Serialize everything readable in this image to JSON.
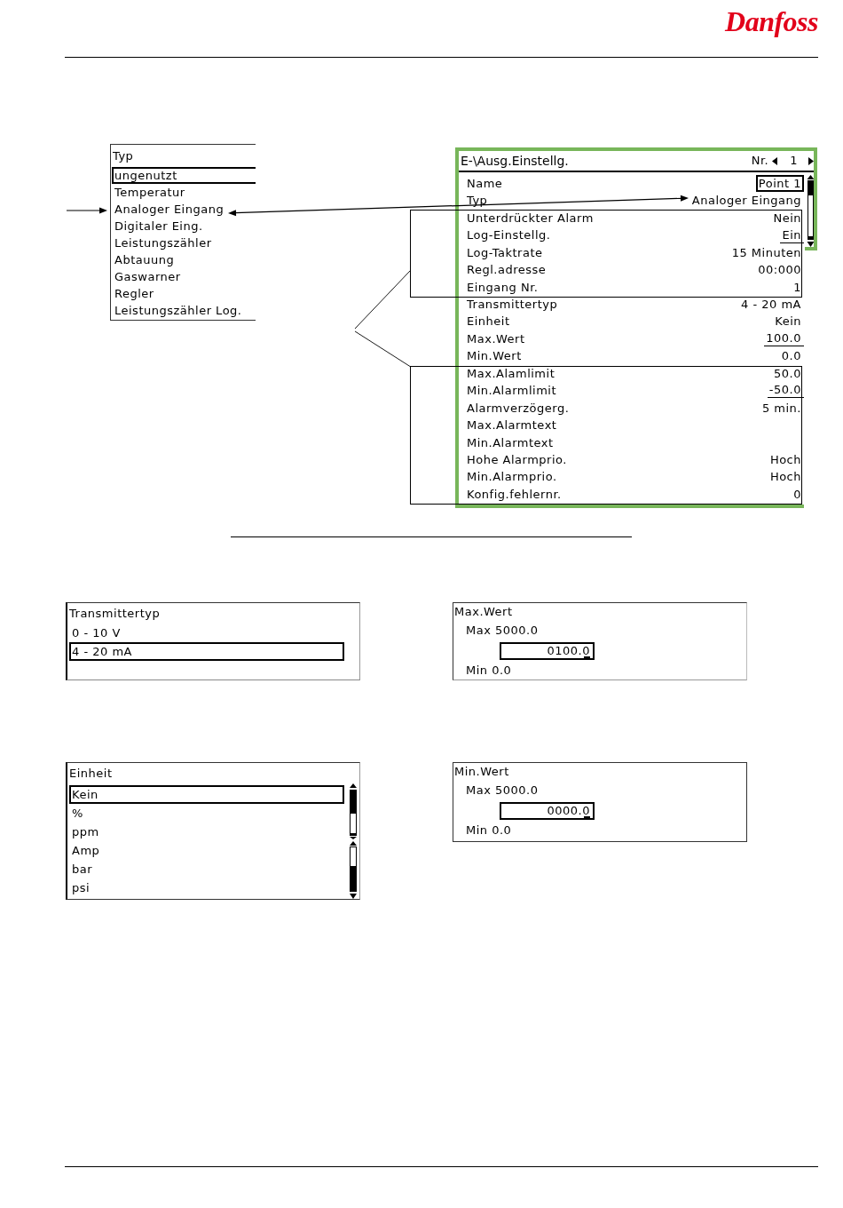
{
  "header": {
    "logo": "Danfoss"
  },
  "type_menu": {
    "title": "Typ",
    "items": [
      {
        "label": "ungenutzt",
        "selected": true
      },
      {
        "label": "Temperatur",
        "selected": false
      },
      {
        "label": "Analoger Eingang",
        "selected": false
      },
      {
        "label": "Digitaler Eing.",
        "selected": false
      },
      {
        "label": "Leistungszähler",
        "selected": false
      },
      {
        "label": "Abtauung",
        "selected": false
      },
      {
        "label": "Gaswarner",
        "selected": false
      },
      {
        "label": "Regler",
        "selected": false
      },
      {
        "label": "Leistungszähler Log.",
        "selected": false
      }
    ]
  },
  "settings_panel": {
    "title": "E-\\Ausg.Einstellg.",
    "number_label": "Nr.",
    "number": "1",
    "rows": [
      {
        "label": "Name",
        "value": "Point 1",
        "kind": "boxed"
      },
      {
        "label": "Typ",
        "value": "Analoger Eingang",
        "kind": "plain"
      },
      {
        "label": "Unterdrückter Alarm",
        "value": "Nein",
        "kind": "plain"
      },
      {
        "label": "Log-Einstellg.",
        "value": "Ein",
        "kind": "underlined"
      },
      {
        "label": "Log-Taktrate",
        "value": "15 Minuten",
        "kind": "plain"
      },
      {
        "label": "Regl.adresse",
        "value": "00:000",
        "kind": "plain"
      },
      {
        "label": "Eingang Nr.",
        "value": "1",
        "kind": "plain"
      },
      {
        "label": "Transmittertyp",
        "value": "4 - 20 mA",
        "kind": "plain"
      },
      {
        "label": "Einheit",
        "value": "Kein",
        "kind": "plain"
      },
      {
        "label": "Max.Wert",
        "value": "100.0",
        "kind": "underlined"
      },
      {
        "label": "Min.Wert",
        "value": "0.0",
        "kind": "plain"
      },
      {
        "label": "Max.Alamlimit",
        "value": "50.0",
        "kind": "plain"
      },
      {
        "label": "Min.Alarmlimit",
        "value": "-50.0",
        "kind": "underlined"
      },
      {
        "label": "Alarmverzögerg.",
        "value": "5 min.",
        "kind": "plain"
      },
      {
        "label": "Max.Alarmtext",
        "kind": "plain"
      },
      {
        "label": "Min.Alarmtext",
        "kind": "plain"
      },
      {
        "label": "Hohe Alarmprio.",
        "value": "Hoch",
        "kind": "plain"
      },
      {
        "label": "Min.Alarmprio.",
        "value": "Hoch",
        "kind": "plain"
      },
      {
        "label": "Konfig.fehlernr.",
        "value": "0",
        "kind": "plain"
      }
    ]
  },
  "transmitter_dialog": {
    "title": "Transmittertyp",
    "options": [
      {
        "label": "0 - 10 V",
        "selected": false
      },
      {
        "label": "4 - 20 mA",
        "selected": true
      }
    ]
  },
  "max_value_dialog": {
    "title": "Max.Wert",
    "max_label": "Max 5000.0",
    "value": "0100.0",
    "cursor": true,
    "min_label": "Min 0.0"
  },
  "unit_dialog": {
    "title": "Einheit",
    "options": [
      {
        "label": "Kein",
        "selected": true
      },
      {
        "label": "%",
        "selected": false
      },
      {
        "label": "ppm",
        "selected": false
      },
      {
        "label": "Amp",
        "selected": false
      },
      {
        "label": "bar",
        "selected": false
      },
      {
        "label": "psi",
        "selected": false
      }
    ]
  },
  "min_value_dialog": {
    "title": "Min.Wert",
    "max_label": "Max 5000.0",
    "value": "0000.0",
    "cursor": true,
    "min_label": "Min 0.0"
  }
}
